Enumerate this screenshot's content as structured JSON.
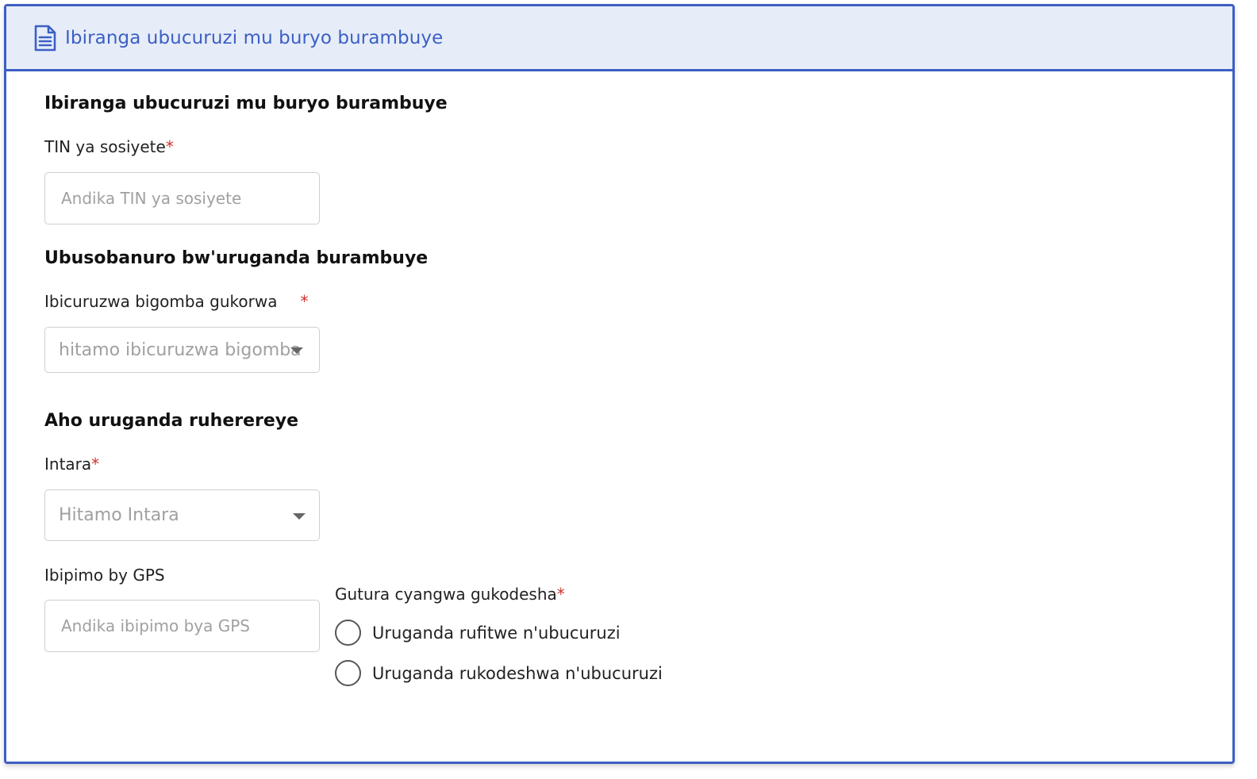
{
  "header": {
    "icon": "document-icon",
    "title": "Ibiranga ubucuruzi mu buryo burambuye"
  },
  "form": {
    "section1_title": "Ibiranga ubucuruzi mu buryo burambuye",
    "tin": {
      "label": "TIN ya sosiyete",
      "required_mark": "*",
      "placeholder": "Andika TIN ya sosiyete",
      "value": ""
    },
    "section2_title": "Ubusobanuro bw'uruganda burambuye",
    "products": {
      "label": "Ibicuruzwa bigomba gukorwa",
      "required_mark": "*",
      "placeholder": "hitamo ibicuruzwa bigomba"
    },
    "section3_title": "Aho uruganda ruherereye",
    "province": {
      "label": "Intara",
      "required_mark": "*",
      "placeholder": "Hitamo Intara"
    },
    "gps": {
      "label": "Ibipimo by GPS",
      "placeholder": "Andika ibipimo bya GPS",
      "value": ""
    },
    "ownership": {
      "label": "Gutura cyangwa gukodesha",
      "required_mark": "*",
      "options": [
        {
          "label": "Uruganda rufitwe n'ubucuruzi",
          "selected": false
        },
        {
          "label": "Uruganda rukodeshwa n'ubucuruzi",
          "selected": false
        }
      ]
    }
  },
  "colors": {
    "accent": "#3d5fc4",
    "header_bg": "#e6edf9",
    "required": "#d0312d",
    "placeholder": "#a0a0a0"
  }
}
